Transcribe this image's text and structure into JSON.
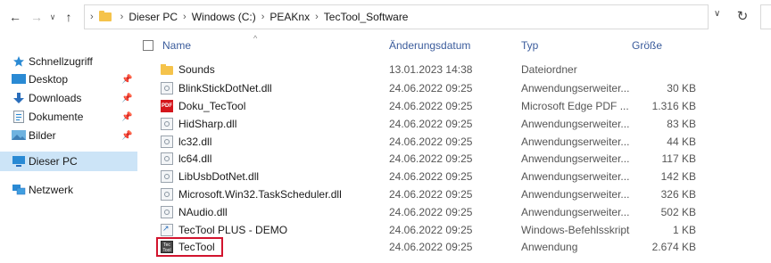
{
  "address_bar": {
    "breadcrumbs": [
      "Dieser PC",
      "Windows (C:)",
      "PEAKnx",
      "TecTool_Software"
    ]
  },
  "nav_pane": {
    "items": [
      {
        "label": "Schnellzugriff",
        "icon": "star-icon",
        "pinned": false
      },
      {
        "label": "Desktop",
        "icon": "desktop-icon",
        "pinned": true
      },
      {
        "label": "Downloads",
        "icon": "download-icon",
        "pinned": true
      },
      {
        "label": "Dokumente",
        "icon": "documents-icon",
        "pinned": true
      },
      {
        "label": "Bilder",
        "icon": "pictures-icon",
        "pinned": true
      },
      {
        "label": "Dieser PC",
        "icon": "computer-icon",
        "pinned": false,
        "selected": true
      },
      {
        "label": "Netzwerk",
        "icon": "network-icon",
        "pinned": false
      }
    ]
  },
  "columns": {
    "name": "Name",
    "date": "Änderungsdatum",
    "type": "Typ",
    "size": "Größe"
  },
  "files": [
    {
      "name": "Sounds",
      "date": "13.01.2023 14:38",
      "type": "Dateiordner",
      "size": "",
      "icon": "folder-icon"
    },
    {
      "name": "BlinkStickDotNet.dll",
      "date": "24.06.2022 09:25",
      "type": "Anwendungserweiter...",
      "size": "30 KB",
      "icon": "dll-icon"
    },
    {
      "name": "Doku_TecTool",
      "date": "24.06.2022 09:25",
      "type": "Microsoft Edge PDF ...",
      "size": "1.316 KB",
      "icon": "pdf-icon"
    },
    {
      "name": "HidSharp.dll",
      "date": "24.06.2022 09:25",
      "type": "Anwendungserweiter...",
      "size": "83 KB",
      "icon": "dll-icon"
    },
    {
      "name": "lc32.dll",
      "date": "24.06.2022 09:25",
      "type": "Anwendungserweiter...",
      "size": "44 KB",
      "icon": "dll-icon"
    },
    {
      "name": "lc64.dll",
      "date": "24.06.2022 09:25",
      "type": "Anwendungserweiter...",
      "size": "117 KB",
      "icon": "dll-icon"
    },
    {
      "name": "LibUsbDotNet.dll",
      "date": "24.06.2022 09:25",
      "type": "Anwendungserweiter...",
      "size": "142 KB",
      "icon": "dll-icon"
    },
    {
      "name": "Microsoft.Win32.TaskScheduler.dll",
      "date": "24.06.2022 09:25",
      "type": "Anwendungserweiter...",
      "size": "326 KB",
      "icon": "dll-icon"
    },
    {
      "name": "NAudio.dll",
      "date": "24.06.2022 09:25",
      "type": "Anwendungserweiter...",
      "size": "502 KB",
      "icon": "dll-icon"
    },
    {
      "name": "TecTool PLUS - DEMO",
      "date": "24.06.2022 09:25",
      "type": "Windows-Befehlsskript",
      "size": "1 KB",
      "icon": "script-icon"
    },
    {
      "name": "TecTool",
      "date": "24.06.2022 09:25",
      "type": "Anwendung",
      "size": "2.674 KB",
      "icon": "tectool-app-icon"
    }
  ],
  "app_icon_text": {
    "line1": "Tec",
    "line2": "Tool"
  },
  "pdf_icon_text": "PDF",
  "highlight_color": "#d2142e",
  "selection_color": "#cce4f7",
  "header_text_color": "#3b5c9c"
}
